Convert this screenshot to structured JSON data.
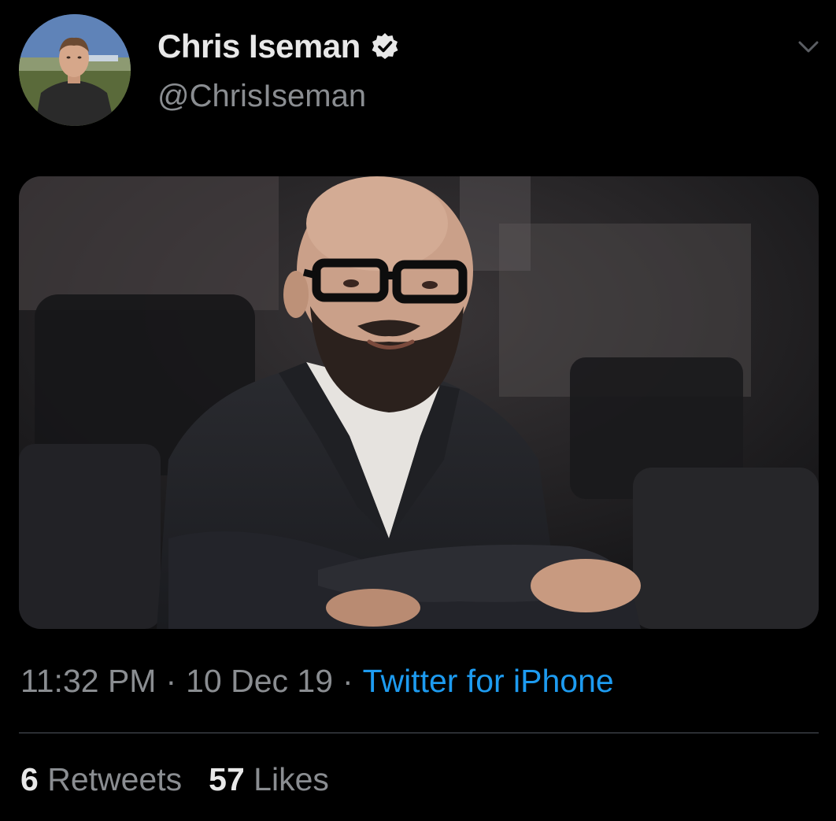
{
  "user": {
    "display_name": "Chris Iseman",
    "handle": "@ChrisIseman",
    "verified": true
  },
  "icons": {
    "verified": "verified-check-icon",
    "menu": "chevron-down-icon"
  },
  "tweet": {
    "time": "11:32 PM",
    "separator": "·",
    "date": "10 Dec 19",
    "source": "Twitter for iPhone"
  },
  "stats": {
    "retweets_count": "6",
    "retweets_label": "Retweets",
    "likes_count": "57",
    "likes_label": "Likes"
  },
  "colors": {
    "background": "#000000",
    "link": "#1d9bf0",
    "secondary_text": "#8a8d91",
    "primary_text": "#e8e8e8"
  }
}
